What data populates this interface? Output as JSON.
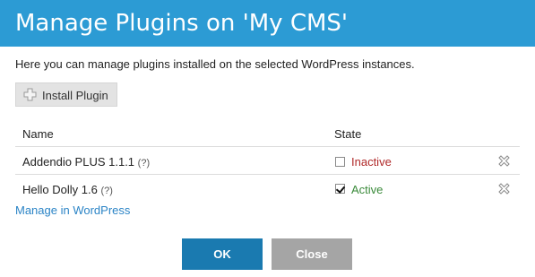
{
  "dialog": {
    "title": "Manage Plugins on 'My CMS'",
    "intro": "Here you can manage plugins installed on the selected WordPress instances.",
    "install_label": "Install Plugin"
  },
  "table": {
    "headers": {
      "name": "Name",
      "state": "State"
    },
    "rows": [
      {
        "name": "Addendio PLUS 1.1.1",
        "help": "(?)",
        "state": "Inactive",
        "checked": false
      },
      {
        "name": "Hello Dolly 1.6",
        "help": "(?)",
        "state": "Active",
        "checked": true
      }
    ]
  },
  "manage_link": "Manage in WordPress",
  "footer": {
    "ok_label": "OK",
    "close_label": "Close"
  },
  "colors": {
    "title_bar": "#2c9bd4",
    "inactive": "#b02a2a",
    "active": "#3a8a3a",
    "ok_button": "#1a7ab0",
    "close_button": "#a5a5a5",
    "link": "#2b84c6"
  }
}
